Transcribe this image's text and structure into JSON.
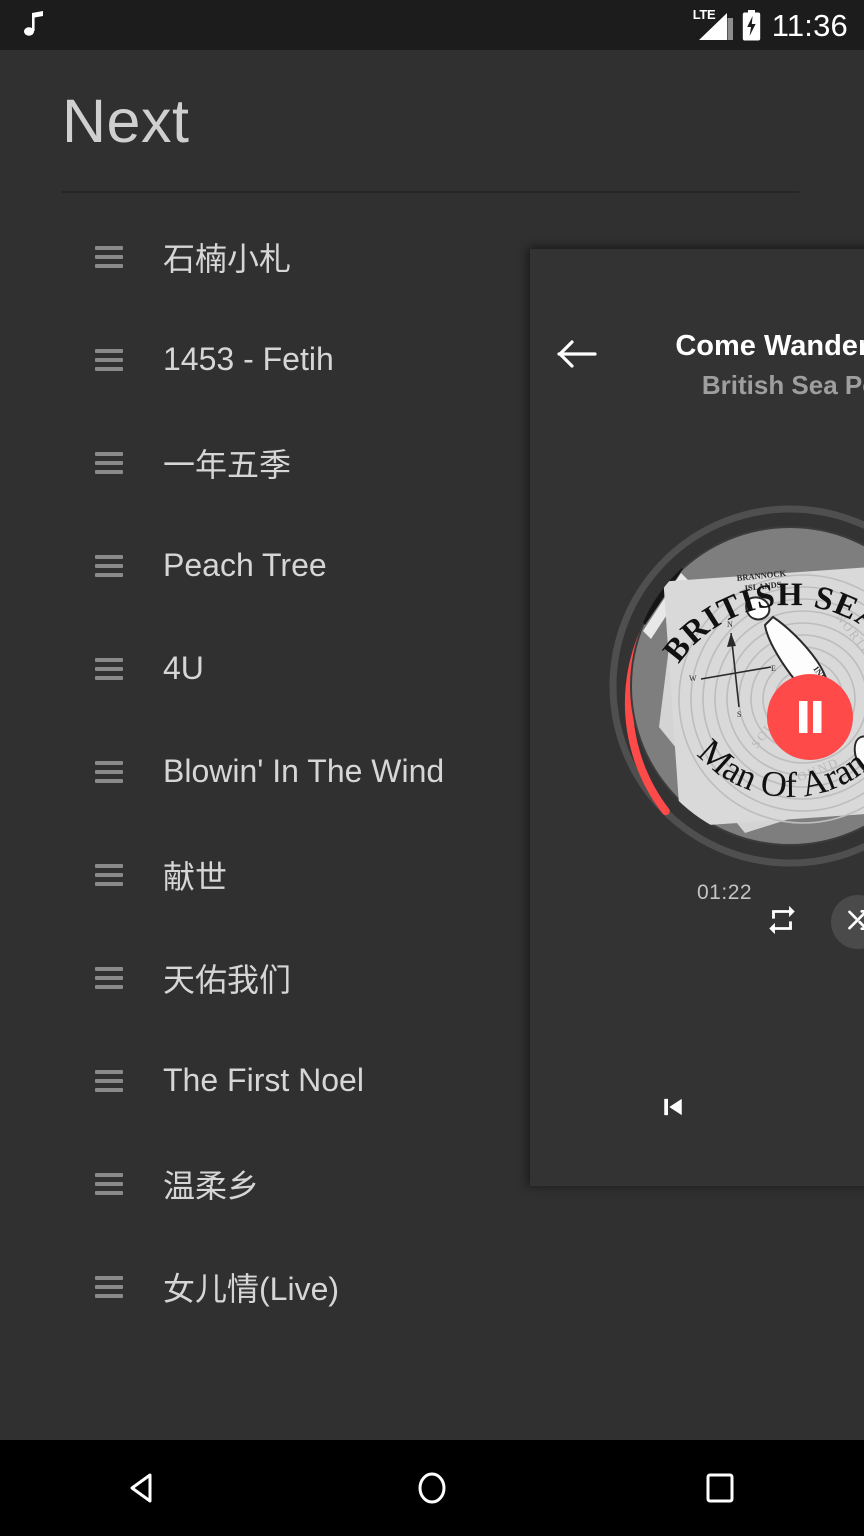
{
  "status_bar": {
    "notification_icon": "music-note-icon",
    "network_label": "LTE",
    "signal_icon": "signal-bars-icon",
    "battery_icon": "battery-charging-icon",
    "clock": "11:36"
  },
  "header": {
    "title": "Next"
  },
  "queue": {
    "items": [
      {
        "title": "石楠小札",
        "handle": "drag-handle-icon"
      },
      {
        "title": "1453 - Fetih",
        "handle": "drag-handle-icon"
      },
      {
        "title": "一年五季",
        "handle": "drag-handle-icon"
      },
      {
        "title": "Peach Tree",
        "handle": "drag-handle-icon"
      },
      {
        "title": "4U",
        "handle": "drag-handle-icon"
      },
      {
        "title": "Blowin' In The Wind",
        "handle": "drag-handle-icon"
      },
      {
        "title": "献世",
        "handle": "drag-handle-icon"
      },
      {
        "title": "天佑我们",
        "handle": "drag-handle-icon"
      },
      {
        "title": "The First Noel",
        "handle": "drag-handle-icon"
      },
      {
        "title": "温柔乡",
        "handle": "drag-handle-icon"
      },
      {
        "title": "女儿情(Live)",
        "handle": "drag-handle-icon"
      }
    ]
  },
  "now_playing": {
    "back_icon": "arrow-left-icon",
    "track_title": "Come Wander W",
    "artist": "British Sea Po",
    "elapsed_time": "01:22",
    "play_state_icon": "pause-icon",
    "repeat_icon": "repeat-icon",
    "shuffle_icon": "shuffle-icon",
    "previous_icon": "skip-previous-icon",
    "album_art": {
      "top_arc_text": "BRITISH SEA",
      "bottom_arc_text": "Man Of Aran",
      "map_labels": [
        "BRANNOCK ISLANDS",
        "NORTH SOUND",
        "SOUTH SOUND",
        "INIS",
        "INISHEER"
      ],
      "compass_labels": [
        "N",
        "E",
        "S",
        "W"
      ]
    },
    "progress_percent": 22
  },
  "nav_bar": {
    "back": "nav-back-icon",
    "home": "nav-home-icon",
    "recents": "nav-recents-icon"
  },
  "colors": {
    "background": "#303030",
    "panel": "#333333",
    "status_bar": "#1c1c1c",
    "accent_red": "#FF4A4A",
    "progress_track": "#5a5a5a",
    "text_primary": "#d6d6d6",
    "text_secondary": "#9e9e9e",
    "nav_bar": "#000000"
  }
}
